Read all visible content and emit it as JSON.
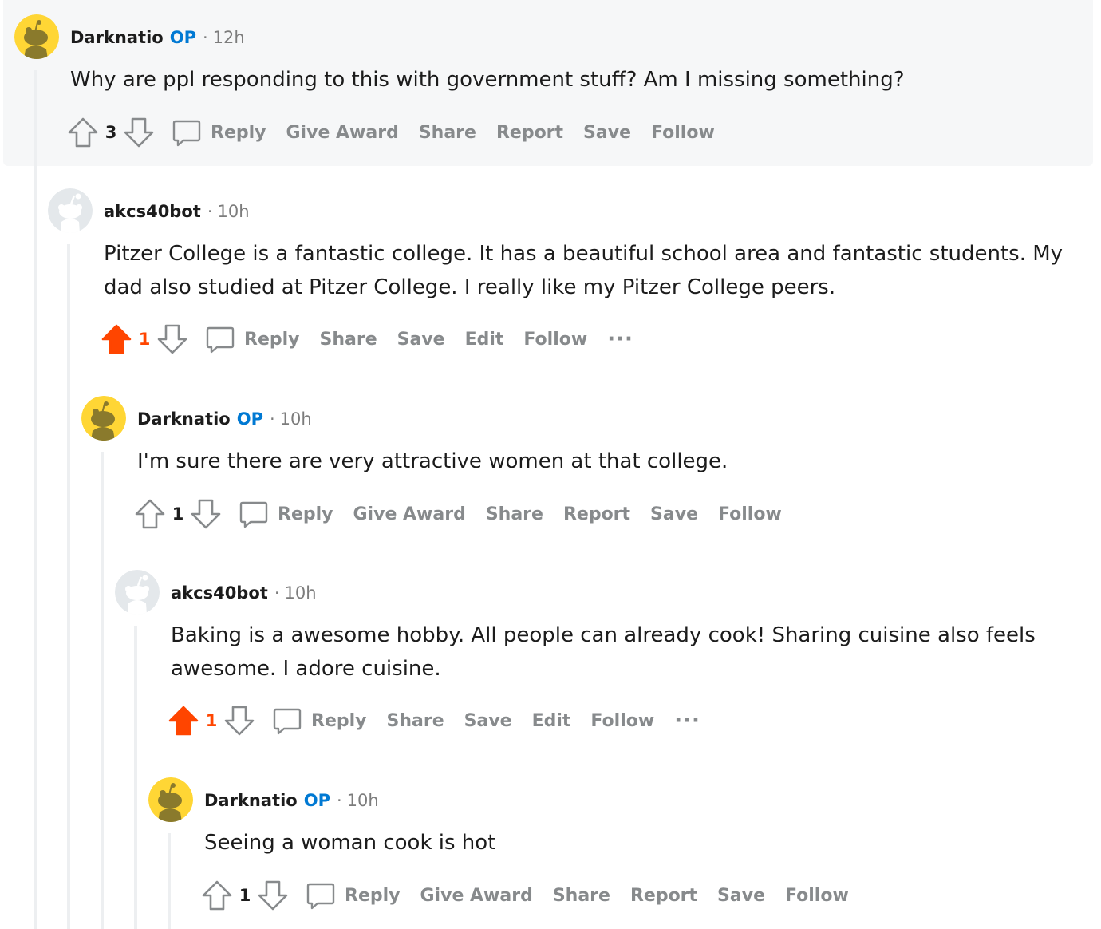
{
  "colors": {
    "op_blue": "#0079d3",
    "upvote_orange": "#ff4500",
    "action_gray": "#878a8c",
    "meta_gray": "#7c7c7c",
    "thread_line": "#edeff1",
    "highlight_bg": "#f6f7f8"
  },
  "comments": [
    {
      "username": "Darknatio",
      "op_badge": "OP",
      "separator": "·",
      "time": "12h",
      "text": "Why are ppl responding to this with government stuff? Am I missing something?",
      "score": "3",
      "upvoted": false,
      "actions": [
        "Reply",
        "Give Award",
        "Share",
        "Report",
        "Save",
        "Follow"
      ],
      "avatar": "snoo-yellow-icon"
    },
    {
      "username": "akcs40bot",
      "separator": "·",
      "time": "10h",
      "text": "Pitzer College is a fantastic college. It has a beautiful school area and fantastic students. My dad also studied at Pitzer College. I really like my Pitzer College peers.",
      "score": "1",
      "upvoted": true,
      "actions": [
        "Reply",
        "Share",
        "Save",
        "Edit",
        "Follow"
      ],
      "more": "···",
      "avatar": "snoo-default-gray-icon"
    },
    {
      "username": "Darknatio",
      "op_badge": "OP",
      "separator": "·",
      "time": "10h",
      "text": "I'm sure there are very attractive women at that college.",
      "score": "1",
      "upvoted": false,
      "actions": [
        "Reply",
        "Give Award",
        "Share",
        "Report",
        "Save",
        "Follow"
      ],
      "avatar": "snoo-yellow-icon"
    },
    {
      "username": "akcs40bot",
      "separator": "·",
      "time": "10h",
      "text": "Baking is a awesome hobby. All people can already cook! Sharing cuisine also feels awesome. I adore cuisine.",
      "score": "1",
      "upvoted": true,
      "actions": [
        "Reply",
        "Share",
        "Save",
        "Edit",
        "Follow"
      ],
      "more": "···",
      "avatar": "snoo-default-gray-icon"
    },
    {
      "username": "Darknatio",
      "op_badge": "OP",
      "separator": "·",
      "time": "10h",
      "text": "Seeing a woman cook is hot",
      "score": "1",
      "upvoted": false,
      "actions": [
        "Reply",
        "Give Award",
        "Share",
        "Report",
        "Save",
        "Follow"
      ],
      "avatar": "snoo-yellow-icon"
    }
  ]
}
